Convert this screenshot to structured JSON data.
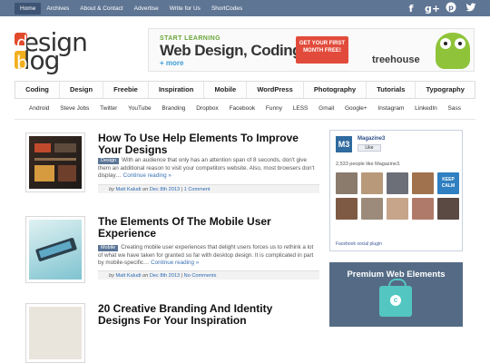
{
  "topnav": [
    "Home",
    "Archives",
    "About & Contact",
    "Advertise",
    "Write for Us",
    "ShortCodes"
  ],
  "social": {
    "facebook": "f",
    "googleplus": "g+",
    "pinterest": "p",
    "twitter": "t"
  },
  "logo": {
    "line1": "esign",
    "line2": "log"
  },
  "ad": {
    "kicker": "START LEARNING",
    "headline": "Web Design, Coding",
    "sub": "+ more",
    "cta": "GET YOUR FIRST MONTH FREE!",
    "brand": "treehouse"
  },
  "categories": [
    "Coding",
    "Design",
    "Freebie",
    "Inspiration",
    "Mobile",
    "WordPress",
    "Photography",
    "Tutorials",
    "Typography"
  ],
  "tags": [
    "Android",
    "Steve Jobs",
    "Twitter",
    "YouTube",
    "Branding",
    "Dropbox",
    "Facebook",
    "Funny",
    "LESS",
    "Gmail",
    "Google+",
    "Instagram",
    "LinkedIn",
    "Sass"
  ],
  "posts": [
    {
      "title": "How To Use Help Elements To Improve Your Designs",
      "badge": "Design",
      "excerpt": "With an audience that only has an attention span of 8 seconds, don't give them an additional reason to visit your competitors website. Also, most browsers don't display…",
      "more": "Continue reading »",
      "by": "by",
      "author": "Matt Kaludi",
      "on": "on",
      "date": "Dec 8th 2013",
      "comments": "1 Comment"
    },
    {
      "title": "The Elements Of The Mobile User Experience",
      "badge": "Mobile",
      "excerpt": "Creating mobile user experiences that delight users forces us to rethink a lot of what we have taken for granted so far with desktop design. It is complicated in part by mobile-specific…",
      "more": "Continue reading »",
      "by": "by",
      "author": "Matt Kaludi",
      "on": "on",
      "date": "Dec 8th 2013",
      "comments": "No Comments"
    },
    {
      "title": "20 Creative Branding And Identity Designs For Your Inspiration"
    }
  ],
  "facebook_box": {
    "logo": "M3",
    "page": "Magazine3",
    "like": "Like",
    "count": "2,533 people like Magazine3.",
    "plugin": "Facebook social plugin",
    "faces_label": "KEEP CALM"
  },
  "widget": {
    "title": "Premium Web Elements",
    "icon": "c"
  }
}
